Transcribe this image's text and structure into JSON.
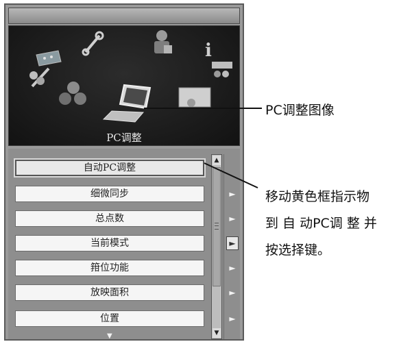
{
  "selected_icon_label": "PC调整",
  "menu_items": [
    {
      "label": "自动PC调整",
      "selected": true
    },
    {
      "label": "细微同步"
    },
    {
      "label": "总点数"
    },
    {
      "label": "当前模式"
    },
    {
      "label": "箝位功能"
    },
    {
      "label": "放映面积"
    },
    {
      "label": "位置"
    }
  ],
  "scroll": {
    "up": "▲",
    "down": "▼",
    "more": "▼"
  },
  "side_arrow": "►",
  "callouts": {
    "pc_icon": "PC调整图像",
    "instruction_line1": "移动黄色框指示物",
    "instruction_line2": "到 自 动PC调 整 并",
    "instruction_line3": "按选择键。"
  }
}
